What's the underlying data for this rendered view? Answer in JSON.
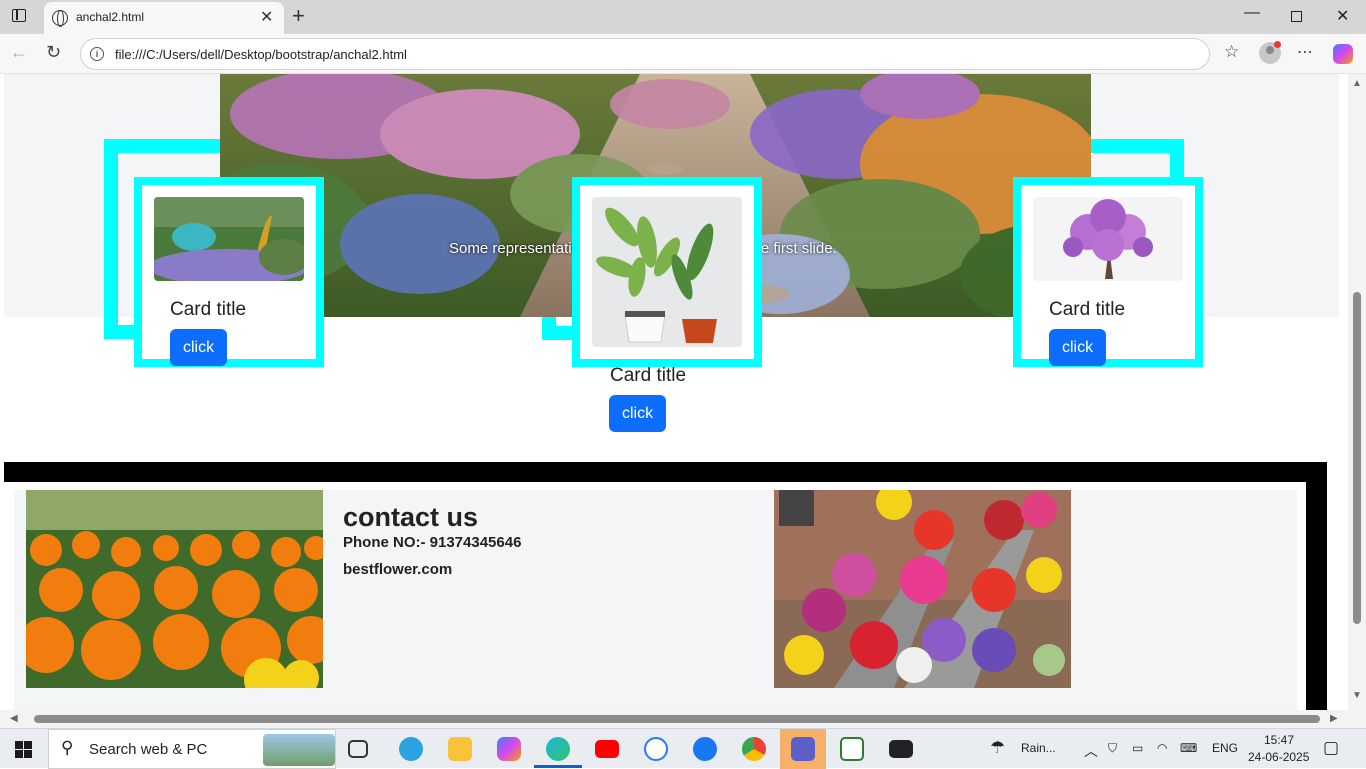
{
  "browser": {
    "tab_title": "anchal2.html",
    "url": "file:///C:/Users/dell/Desktop/bootstrap/anchal2.html"
  },
  "carousel": {
    "caption": "Some representative placeholder content for the first slide."
  },
  "cards": [
    {
      "title": "Card title",
      "button": "click"
    },
    {
      "title": "Card title",
      "button": "click"
    },
    {
      "title": "Card title",
      "button": "click"
    }
  ],
  "footer": {
    "heading": "contact us",
    "phone": "Phone NO:- 91374345646",
    "website": "bestflower.com"
  },
  "taskbar": {
    "search_placeholder": "Search web & PC",
    "weather": "Rain...",
    "language": "ENG",
    "time": "15:47",
    "date": "24-06-2025"
  },
  "colors": {
    "accent": "#0d6efd",
    "frame": "#00ffff"
  }
}
